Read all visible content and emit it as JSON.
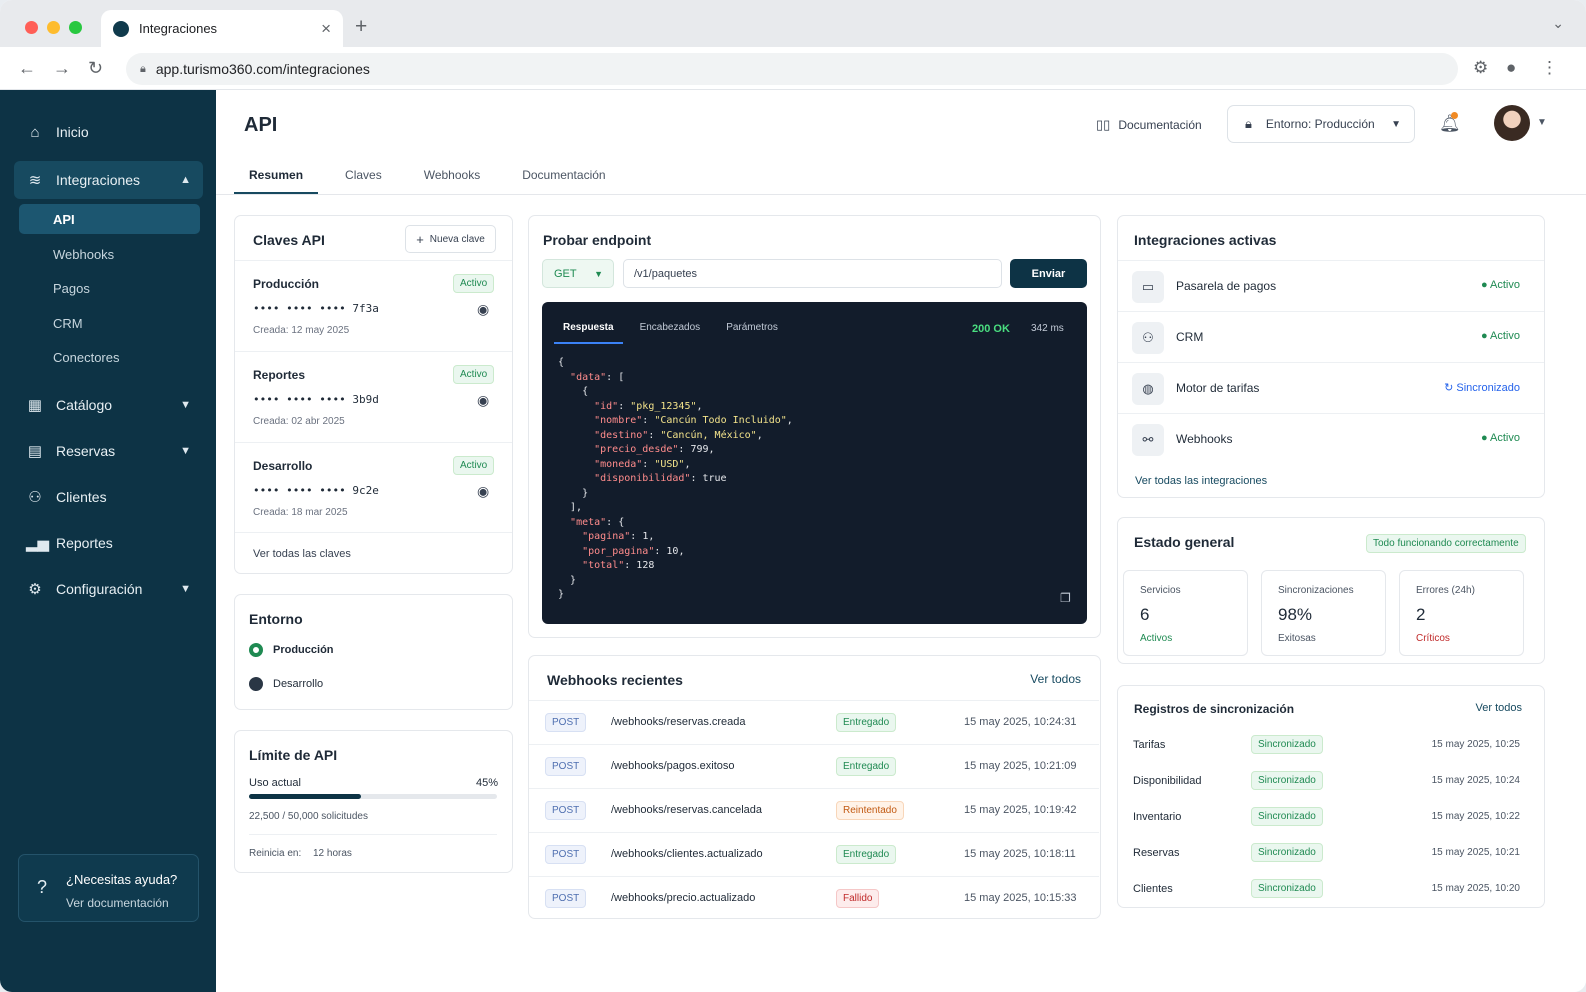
{
  "browser": {
    "tab_title": "Integraciones",
    "url": "app.turismo360.com/integraciones"
  },
  "colors": {
    "sidebar": "#0d3345",
    "accent": "#174a60",
    "success": "#1f8a52",
    "warning": "#c25a12",
    "danger": "#c02a2a"
  },
  "sidebar": {
    "items": [
      {
        "label": "Inicio",
        "icon": "home-icon"
      },
      {
        "label": "Integraciones",
        "icon": "database-icon"
      },
      {
        "label": "Catálogo",
        "icon": "grid-icon"
      },
      {
        "label": "Reservas",
        "icon": "calendar-icon"
      },
      {
        "label": "Clientes",
        "icon": "users-icon"
      },
      {
        "label": "Reportes",
        "icon": "bar-chart-icon"
      },
      {
        "label": "Configuración",
        "icon": "gear-icon"
      }
    ],
    "subitems": [
      "API",
      "Webhooks",
      "Pagos",
      "CRM",
      "Conectores"
    ],
    "help": {
      "title": "¿Necesitas ayuda?",
      "link": "Ver documentación"
    }
  },
  "header": {
    "title": "API",
    "docs": "Documentación",
    "env_label": "Entorno:",
    "env_value": "Producción"
  },
  "tabs": [
    "Resumen",
    "Claves",
    "Webhooks",
    "Documentación"
  ],
  "keys": {
    "title": "Claves API",
    "new_button": "Nueva clave",
    "items": [
      {
        "name": "Producción",
        "mask": "•••• •••• •••• 7f3a",
        "date": "Creada: 12 may 2025",
        "status": "Activo"
      },
      {
        "name": "Reportes",
        "mask": "•••• •••• •••• 3b9d",
        "date": "Creada: 02 abr 2025",
        "status": "Activo"
      },
      {
        "name": "Desarrollo",
        "mask": "•••• •••• •••• 9c2e",
        "date": "Creada: 18 mar 2025",
        "status": "Activo"
      }
    ],
    "see_all": "Ver todas las claves"
  },
  "environment": {
    "title": "Entorno",
    "options": [
      "Producción",
      "Desarrollo"
    ],
    "selected": "Producción"
  },
  "limit": {
    "title": "Límite de API",
    "usage_label": "Uso actual",
    "percent": "45%",
    "percent_value": 0.45,
    "requests": "22,500 / 50,000 solicitudes",
    "reset_label": "Reinicia en:",
    "reset_value": "12 horas"
  },
  "endpoint": {
    "title": "Probar endpoint",
    "method": "GET",
    "path": "/v1/paquetes",
    "send": "Enviar",
    "tabs": [
      "Respuesta",
      "Encabezados",
      "Parámetros"
    ],
    "status": "200 OK",
    "time": "342 ms",
    "response": {
      "data": [
        {
          "id": "pkg_12345",
          "nombre": "Cancún Todo Incluido",
          "destino": "Cancún, México",
          "precio_desde": 799,
          "moneda": "USD",
          "disponibilidad": true
        }
      ],
      "meta": {
        "pagina": 1,
        "por_pagina": 10,
        "total": 128
      }
    }
  },
  "webhooks": {
    "title": "Webhooks recientes",
    "see_all": "Ver todos",
    "rows": [
      {
        "method": "POST",
        "path": "/webhooks/reservas.creada",
        "status": "Entregado",
        "tone": "green",
        "time": "15 may 2025, 10:24:31"
      },
      {
        "method": "POST",
        "path": "/webhooks/pagos.exitoso",
        "status": "Entregado",
        "tone": "green",
        "time": "15 may 2025, 10:21:09"
      },
      {
        "method": "POST",
        "path": "/webhooks/reservas.cancelada",
        "status": "Reintentado",
        "tone": "orange",
        "time": "15 may 2025, 10:19:42"
      },
      {
        "method": "POST",
        "path": "/webhooks/clientes.actualizado",
        "status": "Entregado",
        "tone": "green",
        "time": "15 may 2025, 10:18:11"
      },
      {
        "method": "POST",
        "path": "/webhooks/precio.actualizado",
        "status": "Fallido",
        "tone": "red",
        "time": "15 may 2025, 10:15:33"
      }
    ]
  },
  "integrations": {
    "title": "Integraciones activas",
    "items": [
      {
        "name": "Pasarela de pagos",
        "status": "Activo",
        "icon": "card-icon"
      },
      {
        "name": "CRM",
        "status": "Activo",
        "icon": "users-icon"
      },
      {
        "name": "Motor de tarifas",
        "status": "Sincronizado",
        "icon": "globe-icon"
      },
      {
        "name": "Webhooks",
        "status": "Activo",
        "icon": "webhook-icon"
      }
    ],
    "see_all": "Ver todas las integraciones"
  },
  "health": {
    "title": "Estado general",
    "badge": "Todo funcionando correctamente",
    "stats": [
      {
        "label": "Servicios",
        "value": "6",
        "sub": "Activos",
        "color": "#1f8a52"
      },
      {
        "label": "Sincronizaciones",
        "value": "98%",
        "sub": "Exitosas",
        "color": "#4b5563"
      },
      {
        "label": "Errores (24h)",
        "value": "2",
        "sub": "Críticos",
        "color": "#c02a2a"
      }
    ]
  },
  "sync": {
    "title": "Registros de sincronización",
    "see_all": "Ver todos",
    "rows": [
      {
        "name": "Tarifas",
        "status": "Sincronizado",
        "time": "15 may 2025, 10:25"
      },
      {
        "name": "Disponibilidad",
        "status": "Sincronizado",
        "time": "15 may 2025, 10:24"
      },
      {
        "name": "Inventario",
        "status": "Sincronizado",
        "time": "15 may 2025, 10:22"
      },
      {
        "name": "Reservas",
        "status": "Sincronizado",
        "time": "15 may 2025, 10:21"
      },
      {
        "name": "Clientes",
        "status": "Sincronizado",
        "time": "15 may 2025, 10:20"
      }
    ]
  }
}
